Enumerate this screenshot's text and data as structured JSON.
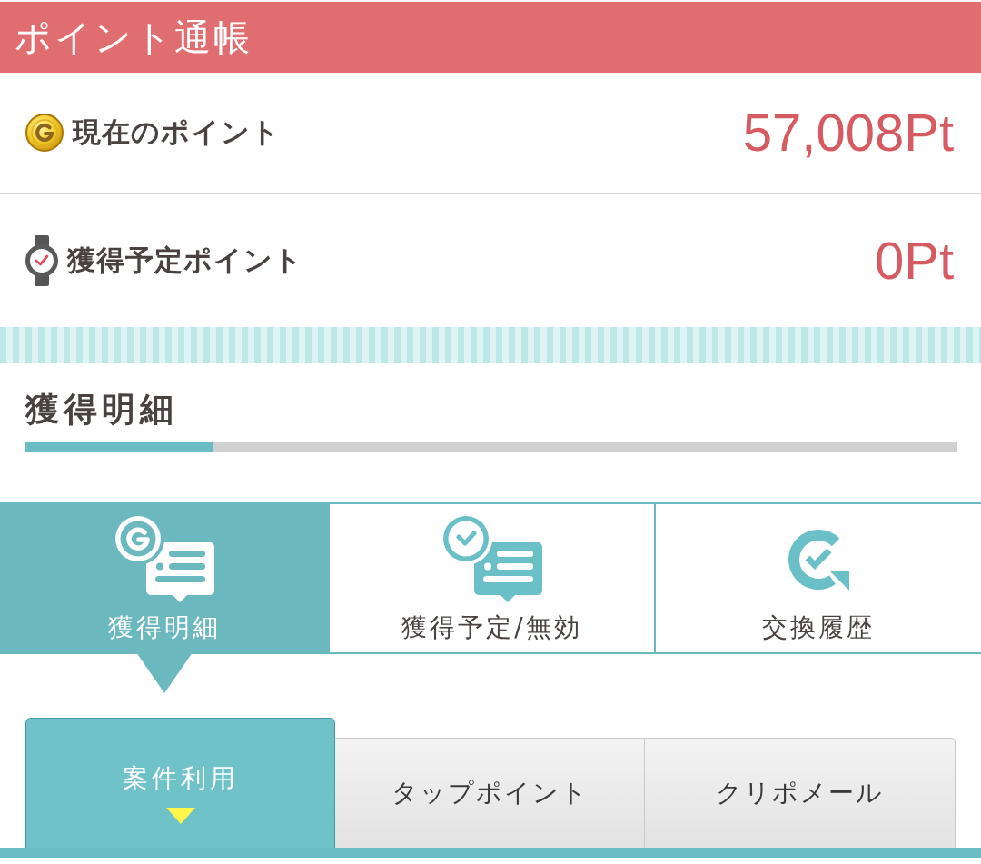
{
  "header": {
    "title": "ポイント通帳"
  },
  "points": [
    {
      "kind": "coin",
      "label": "現在のポイント",
      "value": "57,008Pt"
    },
    {
      "kind": "watch",
      "label": "獲得予定ポイント",
      "value": "0Pt"
    }
  ],
  "section": {
    "title": "獲得明細"
  },
  "tabs": [
    {
      "kind": "coin-list",
      "label": "獲得明細",
      "selected": true
    },
    {
      "kind": "clock-list",
      "label": "獲得予定/無効",
      "selected": false
    },
    {
      "kind": "exchange",
      "label": "交換履歴",
      "selected": false
    }
  ],
  "subtabs": [
    {
      "label": "案件利用",
      "selected": true
    },
    {
      "label": "タップポイント",
      "selected": false
    },
    {
      "label": "クリポメール",
      "selected": false
    }
  ]
}
